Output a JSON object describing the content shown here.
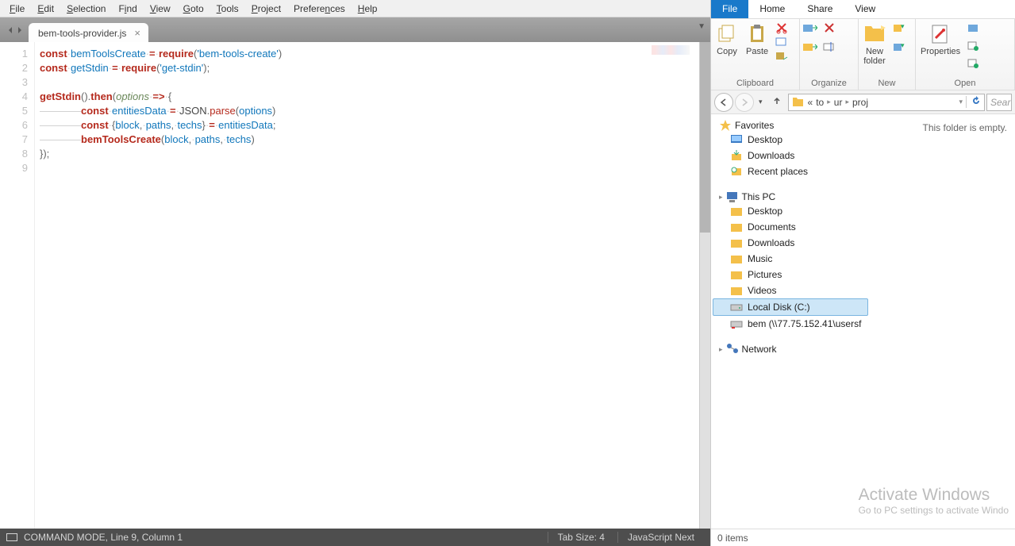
{
  "editor": {
    "menu": [
      "File",
      "Edit",
      "Selection",
      "Find",
      "View",
      "Goto",
      "Tools",
      "Project",
      "Preferences",
      "Help"
    ],
    "tab": {
      "name": "bem-tools-provider.js"
    },
    "gutter": [
      "1",
      "2",
      "3",
      "4",
      "5",
      "6",
      "7",
      "8",
      "9"
    ],
    "status": {
      "mode": "COMMAND MODE, Line 9, Column 1",
      "tabsize": "Tab Size: 4",
      "syntax": "JavaScript Next"
    },
    "code": {
      "l1": {
        "kw": "const",
        "name": "bemToolsCreate",
        "eq": "=",
        "req": "require",
        "str": "'bem-tools-create'"
      },
      "l2": {
        "kw": "const",
        "name": "getStdin",
        "eq": "=",
        "req": "require",
        "str": "'get-stdin'",
        "tail": ";"
      },
      "l4": {
        "call": "getStdin",
        "then": "then",
        "param": "options",
        "arrow": "=>",
        "brace": "{"
      },
      "l5": {
        "kw": "const",
        "name": "entitiesData",
        "eq": "=",
        "json": "JSON",
        "parse": "parse",
        "arg": "options"
      },
      "l6": {
        "kw": "const",
        "a": "block",
        "b": "paths",
        "c": "techs",
        "eq": "=",
        "rhs": "entitiesData",
        "tail": ";"
      },
      "l7": {
        "call": "bemToolsCreate",
        "a": "block",
        "b": "paths",
        "c": "techs"
      },
      "l8": "});"
    }
  },
  "explorer": {
    "tabs": {
      "file": "File",
      "home": "Home",
      "share": "Share",
      "view": "View"
    },
    "ribbon": {
      "copy": "Copy",
      "paste": "Paste",
      "newfolder": "New\nfolder",
      "properties": "Properties",
      "g1": "Clipboard",
      "g2": "Organize",
      "g3": "New",
      "g4": "Open"
    },
    "addr": {
      "pre": "«",
      "a": "to",
      "b": "ur",
      "c": "proj",
      "search": "Sear"
    },
    "nav": {
      "favorites": "Favorites",
      "fav_items": [
        "Desktop",
        "Downloads",
        "Recent places"
      ],
      "thispc": "This PC",
      "pc_items": [
        "Desktop",
        "Documents",
        "Downloads",
        "Music",
        "Pictures",
        "Videos",
        "Local Disk (C:)",
        "bem (\\\\77.75.152.41\\usersf"
      ],
      "network": "Network"
    },
    "content": {
      "empty": "This folder is empty."
    },
    "watermark": {
      "t1": "Activate Windows",
      "t2": "Go to PC settings to activate Windo"
    },
    "status": "0 items"
  }
}
